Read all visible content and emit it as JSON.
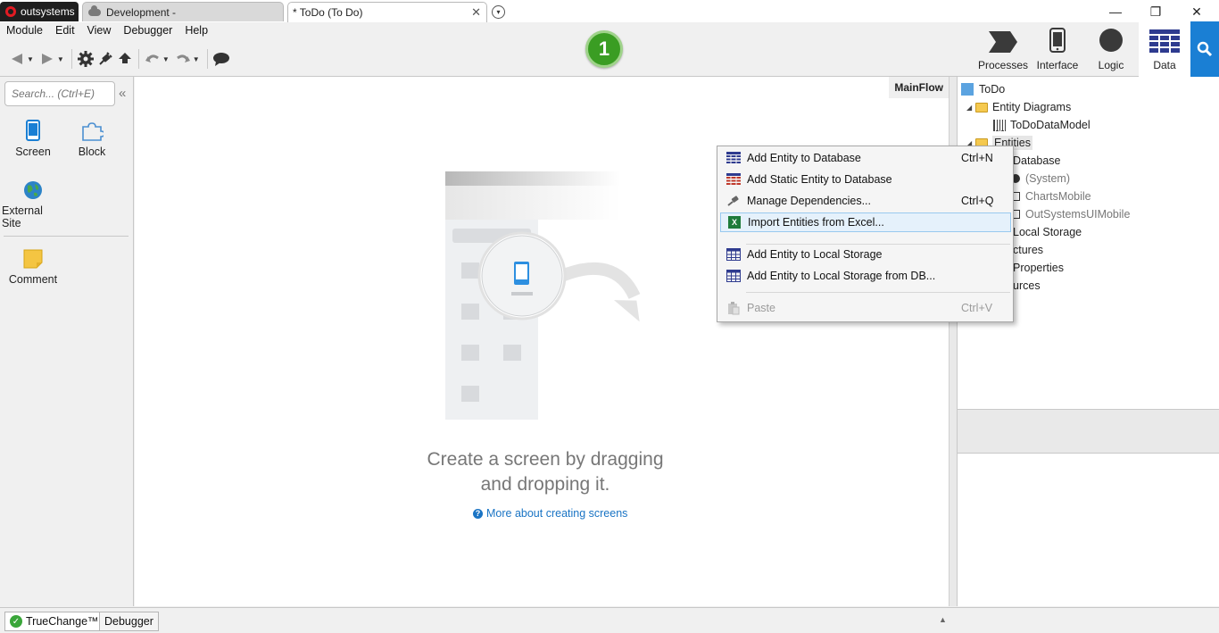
{
  "titlebar": {
    "brand": "outsystems",
    "environment_tab": "Development -",
    "document_tab": "* ToDo (To Do)",
    "close_glyph": "✕",
    "dropdown_glyph": "▾",
    "minimize": "—",
    "restore": "❐",
    "close": "✕"
  },
  "menu": [
    "Module",
    "Edit",
    "View",
    "Debugger",
    "Help"
  ],
  "publish_badge": "1",
  "nav_tabs": [
    {
      "label": "Processes",
      "icon": "processes-icon"
    },
    {
      "label": "Interface",
      "icon": "mobile-icon"
    },
    {
      "label": "Logic",
      "icon": "logic-icon"
    },
    {
      "label": "Data",
      "icon": "data-grid-icon",
      "active": true
    }
  ],
  "left_panel": {
    "search_placeholder": "Search... (Ctrl+E)",
    "tools": [
      {
        "label": "Screen",
        "icon": "screen-icon"
      },
      {
        "label": "Block",
        "icon": "block-icon"
      },
      {
        "label": "External Site",
        "icon": "globe-icon"
      },
      {
        "label": "Comment",
        "icon": "comment-icon"
      }
    ]
  },
  "canvas": {
    "flow_label": "MainFlow",
    "hint_line1": "Create a screen by dragging",
    "hint_line2": "and dropping it.",
    "hint_link": "More about creating screens"
  },
  "tree": {
    "root": "ToDo",
    "entity_diagrams": "Entity Diagrams",
    "data_model": "ToDoDataModel",
    "entities": "Entities",
    "database": "Database",
    "system": "(System)",
    "charts_mobile": "ChartsMobile",
    "outsystems_ui_mobile": "OutSystemsUIMobile",
    "local_storage": "Local Storage",
    "structures": "ctures",
    "site_properties": "Properties",
    "resources": "urces"
  },
  "context_menu": [
    {
      "label": "Add Entity to Database",
      "shortcut": "Ctrl+N",
      "icon": "entity-grid-icon"
    },
    {
      "label": "Add Static Entity to Database",
      "shortcut": "",
      "icon": "static-entity-icon"
    },
    {
      "label": "Manage Dependencies...",
      "shortcut": "Ctrl+Q",
      "icon": "plug-icon"
    },
    {
      "label": "Import Entities from Excel...",
      "shortcut": "",
      "icon": "excel-icon",
      "highlighted": true
    },
    {
      "label": "Add Entity to Local Storage",
      "shortcut": "",
      "icon": "local-entity-icon"
    },
    {
      "label": "Add Entity to Local Storage from DB...",
      "shortcut": "",
      "icon": "local-entity-db-icon"
    },
    {
      "label": "Paste",
      "shortcut": "Ctrl+V",
      "icon": "paste-icon",
      "disabled": true
    }
  ],
  "status_bar": {
    "truechange": "TrueChange™",
    "debugger": "Debugger"
  },
  "colors": {
    "accent_blue": "#1a7fd4",
    "badge_green": "#3a9d23",
    "highlight": "#e5f1fb"
  }
}
